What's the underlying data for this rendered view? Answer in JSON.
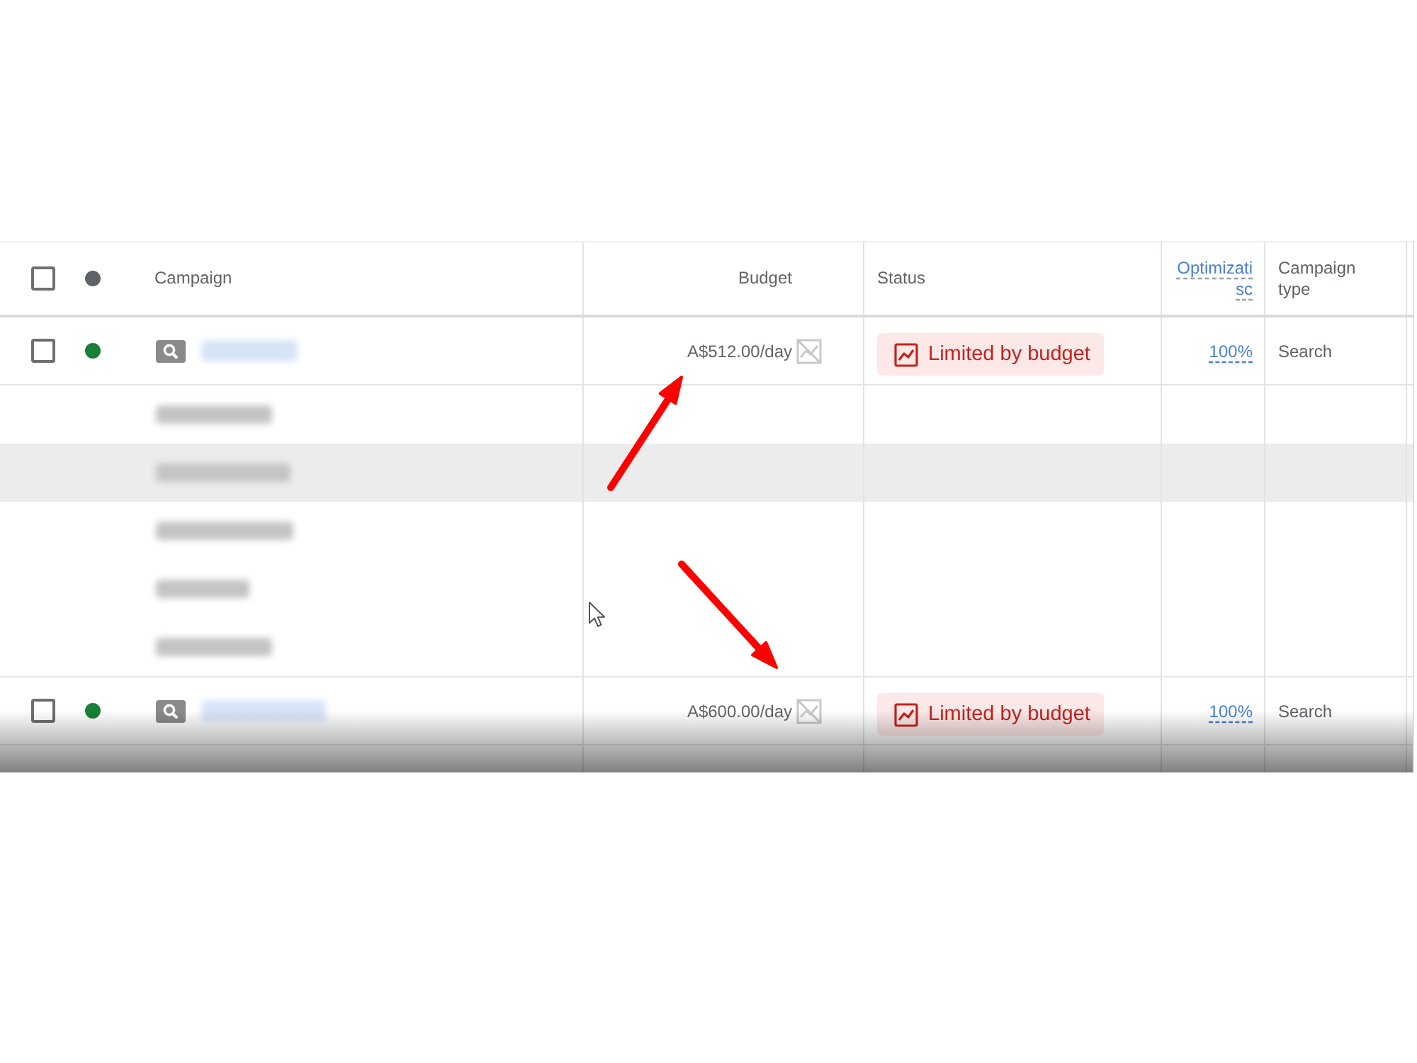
{
  "table": {
    "header": {
      "checked": false,
      "color": "#5f6368",
      "columns": [
        {
          "kind": "text",
          "label": "Campaign"
        },
        {
          "kind": "numeric",
          "label": "Budget"
        },
        {
          "kind": "text",
          "label": "Status"
        },
        {
          "kind": "score",
          "label": "Optimizati\nsc"
        },
        {
          "kind": "text",
          "label": "Campaign type"
        }
      ]
    },
    "rows": [
      {
        "checked": false,
        "color": "#188038",
        "budget": "A$512.00/day",
        "status": "Limited by budget",
        "optimization_score": "100%",
        "campaign_type": "Search",
        "ad_groups": [
          {
            "highlighted": false
          },
          {
            "highlighted": true
          },
          {
            "highlighted": false
          },
          {
            "highlighted": false
          },
          {
            "highlighted": false
          }
        ]
      },
      {
        "checked": false,
        "color": "#188038",
        "budget": "A$600.00/day",
        "status": "Limited by budget",
        "optimization_score": "100%",
        "campaign_type": "Search"
      }
    ]
  }
}
